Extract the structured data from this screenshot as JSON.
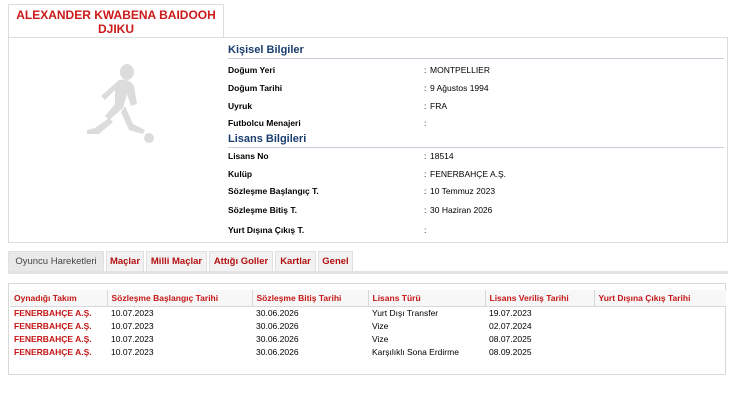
{
  "player": {
    "name_line1": "ALEXANDER KWABENA BAIDOOH",
    "name_line2": "DJIKU"
  },
  "personal": {
    "title": "Kişisel Bilgiler",
    "rows": [
      {
        "label": "Doğum Yeri",
        "value": "MONTPELLIER"
      },
      {
        "label": "Doğum Tarihi",
        "value": "9 Ağustos 1994"
      },
      {
        "label": "Uyruk",
        "value": "FRA"
      },
      {
        "label": "Futbolcu Menajeri",
        "value": ""
      }
    ]
  },
  "license": {
    "title": "Lisans Bilgileri",
    "rows": [
      {
        "label": "Lisans No",
        "value": "18514"
      },
      {
        "label": "Kulüp",
        "value": "FENERBAHÇE A.Ş."
      },
      {
        "label": "Sözleşme Başlangıç T.",
        "value": "10 Temmuz 2023"
      },
      {
        "label": "Sözleşme Bitiş T.",
        "value": "30 Haziran 2026"
      },
      {
        "label": "Yurt Dışına Çıkış T.",
        "value": ""
      }
    ]
  },
  "separator": ":",
  "tabs": [
    {
      "label": "Oyuncu Hareketleri",
      "active": true
    },
    {
      "label": "Maçlar",
      "active": false
    },
    {
      "label": "Milli Maçlar",
      "active": false
    },
    {
      "label": "Attığı Goller",
      "active": false
    },
    {
      "label": "Kartlar",
      "active": false
    },
    {
      "label": "Genel",
      "active": false
    }
  ],
  "table": {
    "headers": [
      "Oynadığı Takım",
      "Sözleşme Başlangıç Tarihi",
      "Sözleşme Bitiş Tarihi",
      "Lisans Türü",
      "Lisans Veriliş Tarihi",
      "Yurt Dışına Çıkış Tarihi"
    ],
    "rows": [
      [
        "FENERBAHÇE A.Ş.",
        "10.07.2023",
        "30.06.2026",
        "Yurt Dışı Transfer",
        "19.07.2023",
        ""
      ],
      [
        "FENERBAHÇE A.Ş.",
        "10.07.2023",
        "30.06.2026",
        "Vize",
        "02.07.2024",
        ""
      ],
      [
        "FENERBAHÇE A.Ş.",
        "10.07.2023",
        "30.06.2026",
        "Vize",
        "08.07.2025",
        ""
      ],
      [
        "FENERBAHÇE A.Ş.",
        "10.07.2023",
        "30.06.2026",
        "Karşılıklı Sona Erdirme",
        "08.09.2025",
        ""
      ]
    ]
  },
  "colors": {
    "accent_red": "#c41515",
    "section_blue": "#1a3d6e"
  }
}
